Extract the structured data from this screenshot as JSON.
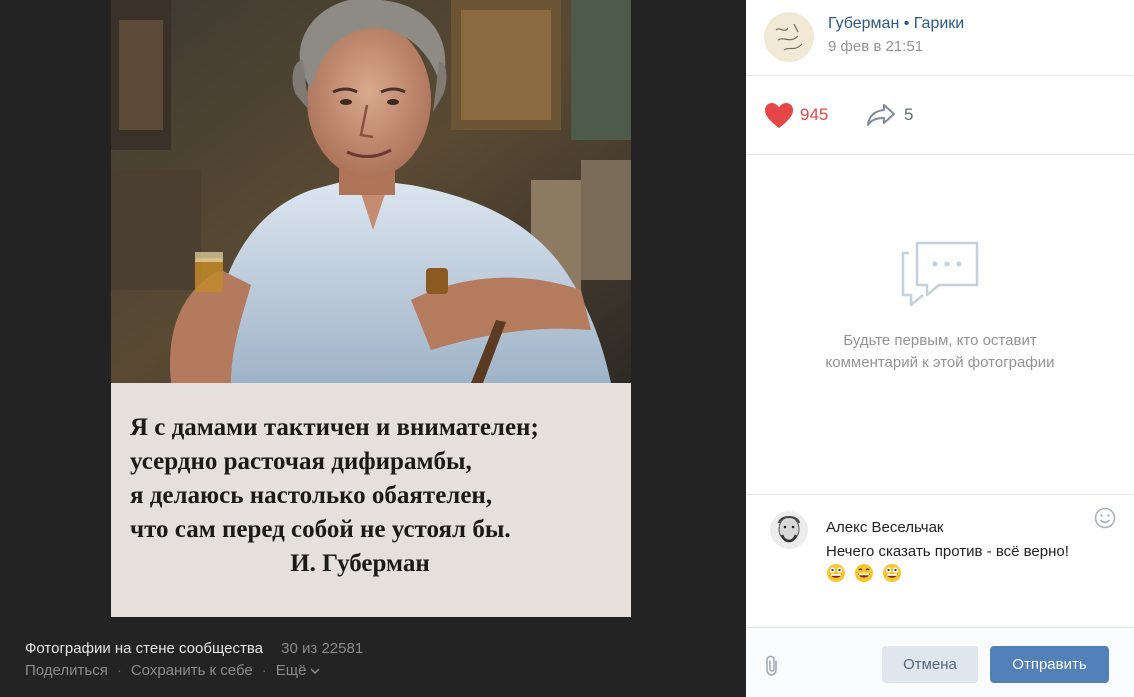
{
  "viewer": {
    "photo": {
      "image_alt": "portrait-photo",
      "poem_lines": [
        "Я с дамами тактичен и внимателен;",
        "усердно расточая дифирамбы,",
        "я делаюсь настолько обаятелен,",
        "что сам перед собой не устоял бы."
      ],
      "poem_author": "И. Губерман"
    },
    "footer": {
      "album_title": "Фотографии на стене сообщества",
      "counter": "30 из 22581",
      "share_label": "Поделиться",
      "save_label": "Сохранить к себе",
      "more_label": "Ещё"
    }
  },
  "panel": {
    "post": {
      "author": "Губерман • Гарики",
      "date": "9 фев в 21:51"
    },
    "reactions": {
      "likes": "945",
      "shares": "5"
    },
    "comments": {
      "empty_text": "Будьте первым, кто оставит комментарий к этой фотографии"
    },
    "composer": {
      "user_name": "Алекс Весельчак",
      "text": "Нечего сказать против - всё верно!",
      "emojis": [
        "grinning-face",
        "grinning-face",
        "grinning-face"
      ]
    },
    "buttons": {
      "cancel": "Отмена",
      "submit": "Отправить"
    }
  },
  "colors": {
    "link_blue": "#2a5885",
    "like_red": "#e64646",
    "primary_button": "#5181b8",
    "viewer_bg": "#232323"
  }
}
